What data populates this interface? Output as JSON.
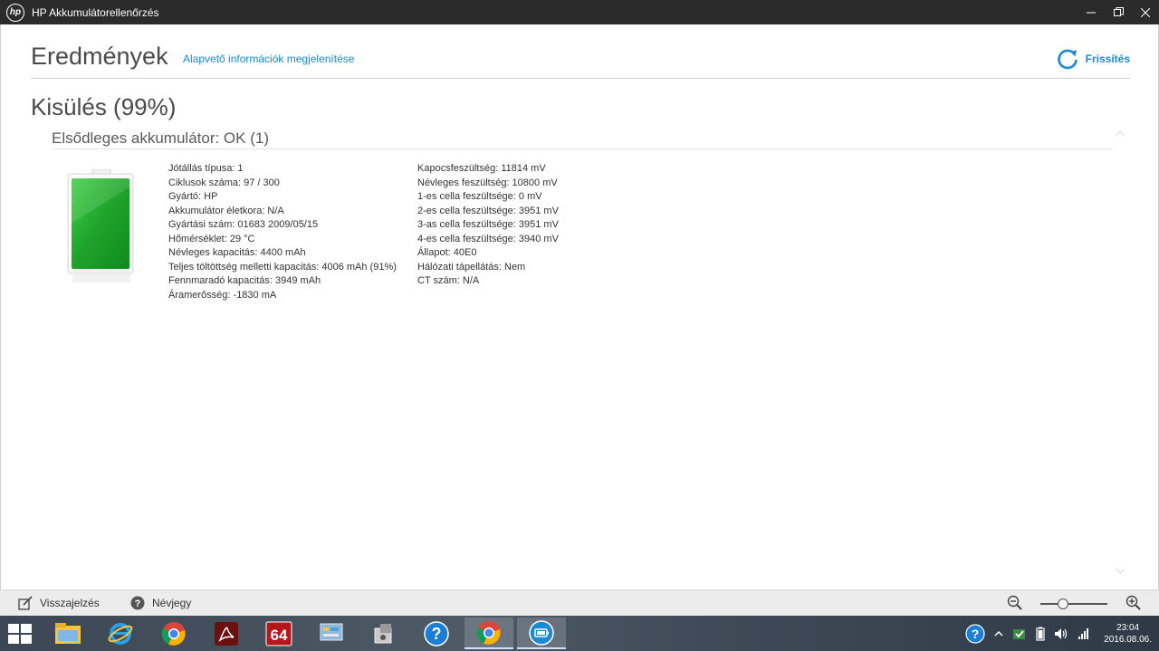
{
  "window": {
    "title": "HP Akkumulátorellenőrzés",
    "logo_text": "hp"
  },
  "header": {
    "title": "Eredmények",
    "info_link": "Alapvető információk megjelenítése",
    "refresh_label": "Frissítés"
  },
  "section": {
    "title": "Kisülés (99%)",
    "subtitle": "Elsődleges akkumulátor:  OK (1)"
  },
  "details_left": [
    "Jótállás típusa: 1",
    "Ciklusok száma: 97 / 300",
    "Gyártó: HP",
    "Akkumulátor életkora: N/A",
    "Gyártási szám: 01683 2009/05/15",
    "Hőmérséklet: 29 °C",
    "Névleges kapacitás: 4400 mAh",
    "Teljes töltöttség melletti kapacitás: 4006 mAh (91%)",
    "Fennmaradó kapacitás: 3949 mAh",
    "Áramerősség: -1830 mA"
  ],
  "details_right": [
    "Kapocsfeszültség: 11814 mV",
    "Névleges feszültség: 10800 mV",
    "1-es cella feszültsége: 0 mV",
    "2-es cella feszültsége: 3951 mV",
    "3-as cella feszültsége: 3951 mV",
    "4-es cella feszültsége: 3940 mV",
    "Állapot: 40E0",
    "Hálózati tápellátás: Nem",
    "CT szám: N/A"
  ],
  "battery": {
    "charge_fraction": 1.0,
    "color": "#1fa32b"
  },
  "footer": {
    "feedback_label": "Visszajelzés",
    "about_label": "Névjegy",
    "zoom_fraction": 0.3
  },
  "taskbar": {
    "time": "23:04",
    "date": "2016.08.06.",
    "app64_label": "64"
  },
  "colors": {
    "accent": "#1a8ad4",
    "titlebar": "#2b2b2b"
  }
}
